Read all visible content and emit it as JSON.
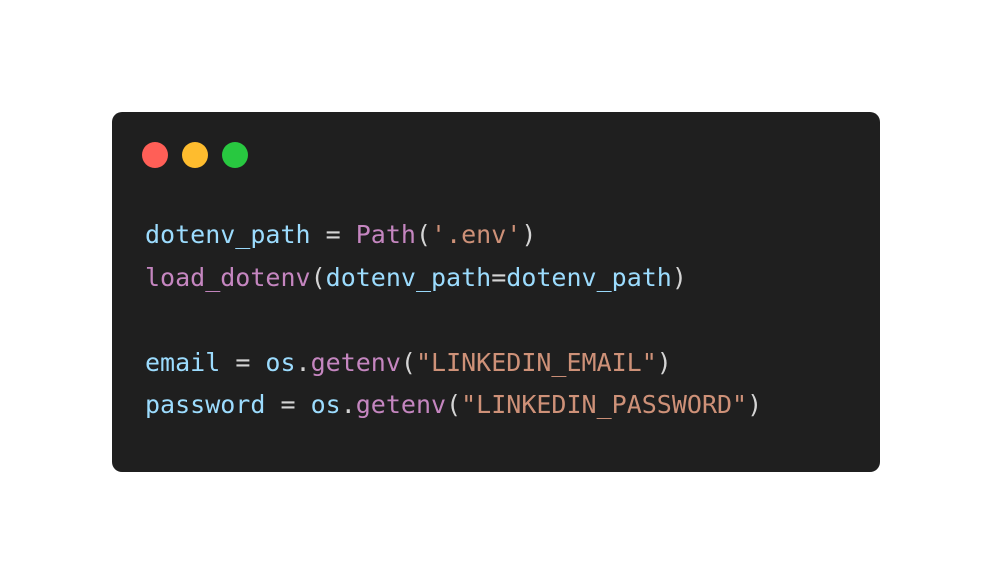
{
  "window": {
    "background": "#1f1f1f",
    "controls": [
      {
        "name": "close",
        "color": "#ff5f57"
      },
      {
        "name": "minimize",
        "color": "#febc2e"
      },
      {
        "name": "maximize",
        "color": "#28c840"
      }
    ]
  },
  "syntax_colors": {
    "variable": "#9cdcfe",
    "function": "#c586c0",
    "string": "#ce9178",
    "punctuation": "#d4d4d4"
  },
  "code": {
    "lines": [
      [
        {
          "t": "dotenv_path",
          "k": "variable"
        },
        {
          "t": " = ",
          "k": "punctuation"
        },
        {
          "t": "Path",
          "k": "function"
        },
        {
          "t": "(",
          "k": "punctuation"
        },
        {
          "t": "'.env'",
          "k": "string"
        },
        {
          "t": ")",
          "k": "punctuation"
        }
      ],
      [
        {
          "t": "load_dotenv",
          "k": "function"
        },
        {
          "t": "(",
          "k": "punctuation"
        },
        {
          "t": "dotenv_path",
          "k": "variable"
        },
        {
          "t": "=",
          "k": "punctuation"
        },
        {
          "t": "dotenv_path",
          "k": "variable"
        },
        {
          "t": ")",
          "k": "punctuation"
        }
      ],
      [],
      [
        {
          "t": "email",
          "k": "variable"
        },
        {
          "t": " = ",
          "k": "punctuation"
        },
        {
          "t": "os",
          "k": "variable"
        },
        {
          "t": ".",
          "k": "punctuation"
        },
        {
          "t": "getenv",
          "k": "function"
        },
        {
          "t": "(",
          "k": "punctuation"
        },
        {
          "t": "\"LINKEDIN_EMAIL\"",
          "k": "string"
        },
        {
          "t": ")",
          "k": "punctuation"
        }
      ],
      [
        {
          "t": "password",
          "k": "variable"
        },
        {
          "t": " = ",
          "k": "punctuation"
        },
        {
          "t": "os",
          "k": "variable"
        },
        {
          "t": ".",
          "k": "punctuation"
        },
        {
          "t": "getenv",
          "k": "function"
        },
        {
          "t": "(",
          "k": "punctuation"
        },
        {
          "t": "\"LINKEDIN_PASSWORD\"",
          "k": "string"
        },
        {
          "t": ")",
          "k": "punctuation"
        }
      ]
    ]
  }
}
